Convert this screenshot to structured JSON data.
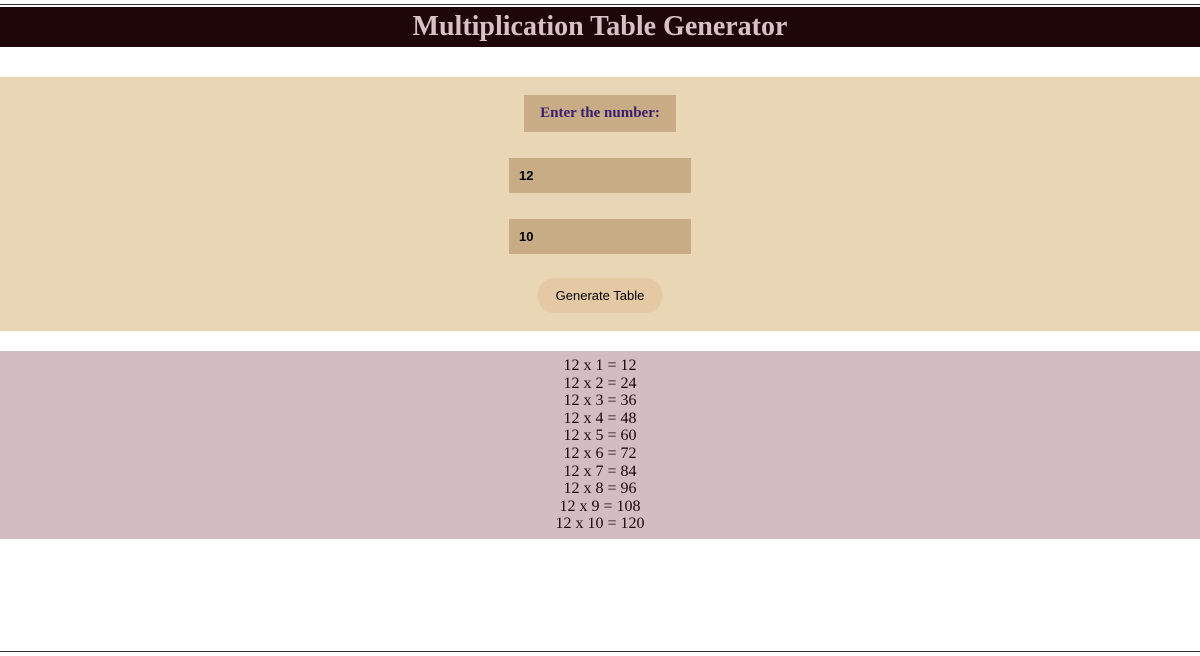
{
  "header": {
    "title": "Multiplication Table Generator"
  },
  "form": {
    "label": "Enter the number:",
    "number_value": "12",
    "count_value": "10",
    "button_label": "Generate Table"
  },
  "results": [
    "12 x 1 = 12",
    "12 x 2 = 24",
    "12 x 3 = 36",
    "12 x 4 = 48",
    "12 x 5 = 60",
    "12 x 6 = 72",
    "12 x 7 = 84",
    "12 x 8 = 96",
    "12 x 9 = 108",
    "12 x 10 = 120"
  ]
}
